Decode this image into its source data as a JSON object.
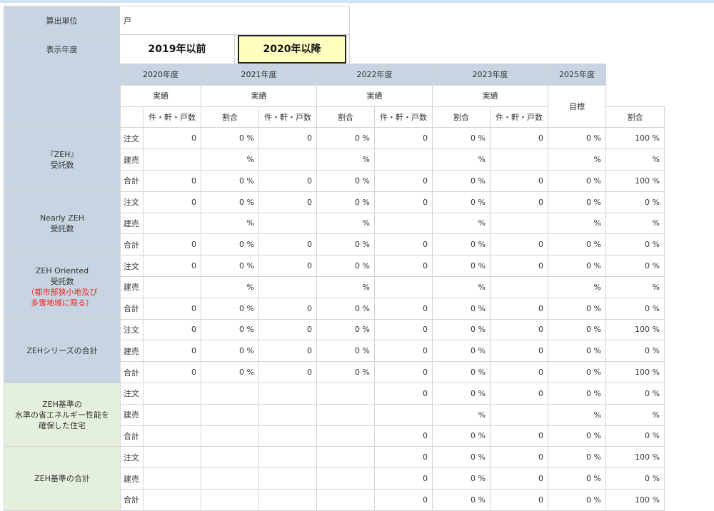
{
  "settings": {
    "unit_label": "算出単位",
    "unit_value": "戸",
    "year_label": "表示年度",
    "year_buttons": [
      "2019年以前",
      "2020年以降"
    ]
  },
  "header": {
    "years": [
      "2020年度",
      "2021年度",
      "2022年度",
      "2023年度"
    ],
    "target_year": "2025年度",
    "actual": "実績",
    "target": "目標",
    "col_count": "件・軒・戸数",
    "col_ratio": "割合"
  },
  "row_labels": [
    "注文",
    "建売",
    "合計"
  ],
  "groups": [
    {
      "lines": [
        "『ZEH』",
        "受託数"
      ],
      "red_lines": [],
      "green": false,
      "rows": [
        {
          "label": "注文",
          "cells": [
            "0",
            "0 %",
            "0",
            "0 %",
            "0",
            "0 %",
            "0",
            "0 %",
            "100 %"
          ]
        },
        {
          "label": "建売",
          "cells": [
            "",
            "%",
            "",
            "%",
            "",
            "%",
            "",
            "%",
            "%"
          ]
        },
        {
          "label": "合計",
          "cells": [
            "0",
            "0 %",
            "0",
            "0 %",
            "0",
            "0 %",
            "0",
            "0 %",
            "100 %"
          ]
        }
      ]
    },
    {
      "lines": [
        "Nearly ZEH",
        "受託数"
      ],
      "red_lines": [],
      "green": false,
      "rows": [
        {
          "label": "注文",
          "cells": [
            "0",
            "0 %",
            "0",
            "0 %",
            "0",
            "0 %",
            "0",
            "0 %",
            "0 %"
          ]
        },
        {
          "label": "建売",
          "cells": [
            "",
            "%",
            "",
            "%",
            "",
            "%",
            "",
            "%",
            "%"
          ]
        },
        {
          "label": "合計",
          "cells": [
            "0",
            "0 %",
            "0",
            "0 %",
            "0",
            "0 %",
            "0",
            "0 %",
            "0 %"
          ]
        }
      ]
    },
    {
      "lines": [
        "ZEH Oriented",
        "受託数"
      ],
      "red_lines": [
        "（都市部狭小地及び",
        "多雪地域に限る）"
      ],
      "green": false,
      "rows": [
        {
          "label": "注文",
          "cells": [
            "0",
            "0 %",
            "0",
            "0 %",
            "0",
            "0 %",
            "0",
            "0 %",
            "0 %"
          ]
        },
        {
          "label": "建売",
          "cells": [
            "",
            "%",
            "",
            "%",
            "",
            "%",
            "",
            "%",
            "%"
          ]
        },
        {
          "label": "合計",
          "cells": [
            "0",
            "0 %",
            "0",
            "0 %",
            "0",
            "0 %",
            "0",
            "0 %",
            "0 %"
          ]
        }
      ]
    },
    {
      "lines": [
        "ZEHシリーズの合計"
      ],
      "red_lines": [],
      "green": false,
      "rows": [
        {
          "label": "注文",
          "cells": [
            "0",
            "0 %",
            "0",
            "0 %",
            "0",
            "0 %",
            "0",
            "0 %",
            "100 %"
          ]
        },
        {
          "label": "建売",
          "cells": [
            "0",
            "0 %",
            "0",
            "0 %",
            "0",
            "0 %",
            "0",
            "0 %",
            "0 %"
          ]
        },
        {
          "label": "合計",
          "cells": [
            "0",
            "0 %",
            "0",
            "0 %",
            "0",
            "0 %",
            "0",
            "0 %",
            "100 %"
          ]
        }
      ]
    },
    {
      "lines": [
        "ZEH基準の",
        "水準の省エネルギー性能を",
        "確保した住宅"
      ],
      "red_lines": [],
      "green": true,
      "rows": [
        {
          "label": "注文",
          "cells": [
            "",
            "",
            "",
            "",
            "0",
            "0 %",
            "0",
            "0 %",
            "0 %"
          ]
        },
        {
          "label": "建売",
          "cells": [
            "",
            "",
            "",
            "",
            "",
            "%",
            "",
            "%",
            "%"
          ]
        },
        {
          "label": "合計",
          "cells": [
            "",
            "",
            "",
            "",
            "0",
            "0 %",
            "0",
            "0 %",
            "0 %"
          ]
        }
      ]
    },
    {
      "lines": [
        "ZEH基準の合計"
      ],
      "red_lines": [],
      "green": true,
      "rows": [
        {
          "label": "注文",
          "cells": [
            "",
            "",
            "",
            "",
            "0",
            "0 %",
            "0",
            "0 %",
            "100 %"
          ]
        },
        {
          "label": "建売",
          "cells": [
            "",
            "",
            "",
            "",
            "0",
            "0 %",
            "0",
            "0 %",
            "0 %"
          ]
        },
        {
          "label": "合計",
          "cells": [
            "",
            "",
            "",
            "",
            "0",
            "0 %",
            "0",
            "0 %",
            "100 %"
          ]
        }
      ]
    }
  ]
}
